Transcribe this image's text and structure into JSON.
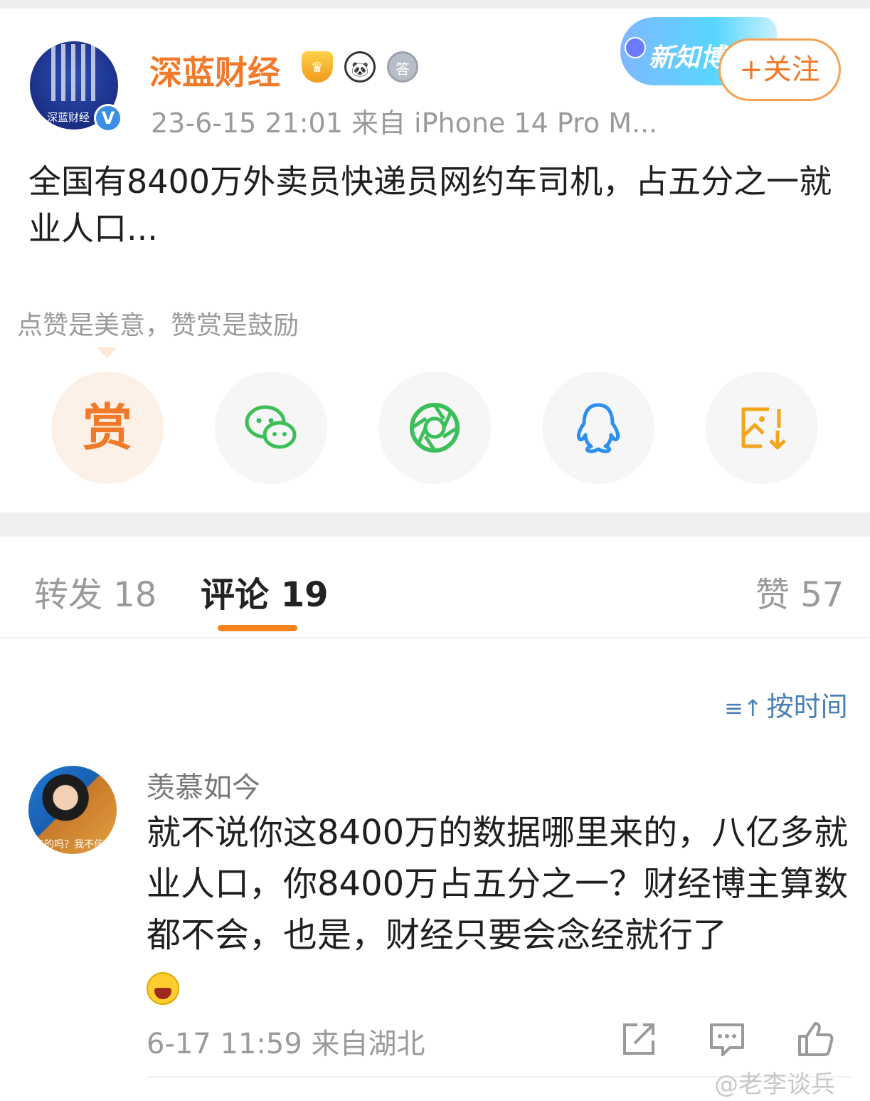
{
  "post": {
    "author": "深蓝财经",
    "avatar_text": "深蓝财经",
    "verified_mark": "V",
    "badges": {
      "vip": "♛",
      "panda": "🐼",
      "medal": "答"
    },
    "meta": "23-6-15 21:01  来自 iPhone 14 Pro M...",
    "banner_label": "新知博",
    "follow_label": "+关注",
    "content": "全国有8400万外卖员快递员网约车司机，占五分之一就业人口..."
  },
  "reward": {
    "hint": "点赞是美意，赞赏是鼓励",
    "reward_char": "赏"
  },
  "share": {
    "icons": [
      "reward-icon",
      "wechat-icon",
      "moments-icon",
      "qq-icon",
      "save-image-icon"
    ]
  },
  "tabs": {
    "repost": "转发 18",
    "comments": "评论 19",
    "likes": "赞 57"
  },
  "sort": {
    "icon": "≡↑",
    "label": "按时间"
  },
  "comment": {
    "user": "羡慕如今",
    "avatar_caption": "真的吗？我不信",
    "text": "就不说你这8400万的数据哪里来的，八亿多就业人口，你8400万占五分之一？财经博主算数都不会，也是，财经只要会念经就行了",
    "meta": "6-17 11:59  来自湖北"
  },
  "watermark": "@老李谈兵",
  "colors": {
    "accent": "#f07a2a",
    "tab_underline": "#f7841b",
    "link": "#4a7fb8",
    "wechat": "#3cbf5a",
    "qq": "#2d8ff0",
    "save": "#f3a51b"
  }
}
